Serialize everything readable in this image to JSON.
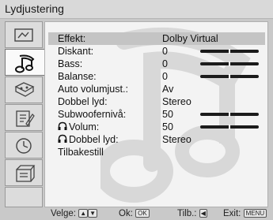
{
  "title": "Lydjustering",
  "sidebar": {
    "items": [
      {
        "icon": "picture-settings-icon",
        "selected": false
      },
      {
        "icon": "sound-settings-icon",
        "selected": true
      },
      {
        "icon": "screen-settings-icon",
        "selected": false
      },
      {
        "icon": "features-icon",
        "selected": false
      },
      {
        "icon": "timer-icon",
        "selected": false
      },
      {
        "icon": "setup-icon",
        "selected": false
      },
      {
        "icon": "empty-slot",
        "selected": false
      }
    ]
  },
  "menu": {
    "rows": [
      {
        "label": "Effekt:",
        "value": "Dolby Virtual",
        "level": null,
        "selected": true
      },
      {
        "label": "Diskant:",
        "value": "0",
        "level": 0.5
      },
      {
        "label": "Bass:",
        "value": "0",
        "level": 0.5
      },
      {
        "label": "Balanse:",
        "value": "0",
        "level": 0.5
      },
      {
        "label": "Auto volumjust.:",
        "value": "Av",
        "level": null
      },
      {
        "label": "Dobbel lyd:",
        "value": "Stereo",
        "level": null
      },
      {
        "label": "Subwoofernivå:",
        "value": "50",
        "level": 0.5
      },
      {
        "label": "Volum:",
        "value": "50",
        "level": 0.5,
        "icon": "headphone-icon"
      },
      {
        "label": "Dobbel lyd:",
        "value": "Stereo",
        "level": null,
        "icon": "headphone-icon"
      },
      {
        "label": "Tilbakestill",
        "value": "",
        "level": null
      }
    ]
  },
  "footer": {
    "select_label": "Velge:",
    "ok_label": "Ok:",
    "ok_key": "OK",
    "back_label": "Tilb.:",
    "exit_label": "Exit:",
    "exit_key": "MENU"
  }
}
